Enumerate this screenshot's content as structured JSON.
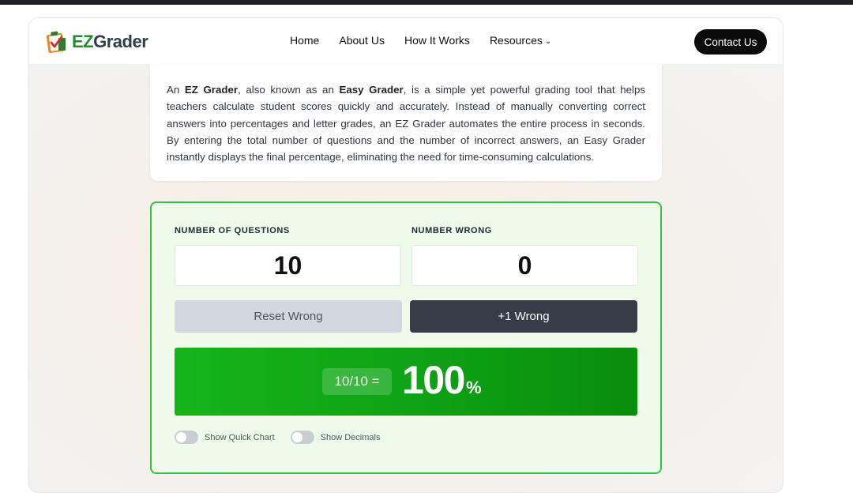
{
  "brand": {
    "ez": "EZ",
    "grader": "Grader"
  },
  "nav": {
    "home": "Home",
    "about": "About Us",
    "how": "How It Works",
    "resources": "Resources",
    "contact": "Contact Us"
  },
  "intro": {
    "p1": "An ",
    "b1": "EZ Grader",
    "p2": ", also known as an ",
    "b2": "Easy Grader",
    "p3": ", is a simple yet powerful grading tool that helps teachers calculate student scores quickly and accurately. Instead of manually converting correct answers into percentages and letter grades, an EZ Grader automates the entire process in seconds. By entering the total number of questions and the number of incorrect answers, an Easy Grader instantly displays the final percentage, eliminating the need for time-consuming calculations."
  },
  "calculator": {
    "questions_label": "NUMBER OF QUESTIONS",
    "questions_value": "10",
    "wrong_label": "NUMBER WRONG",
    "wrong_value": "0",
    "reset_label": "Reset Wrong",
    "plus_label": "+1 Wrong",
    "fraction": "10/10 =",
    "percent": "100",
    "percent_symbol": "%",
    "toggle_chart": "Show Quick Chart",
    "toggle_decimals": "Show Decimals"
  },
  "colors": {
    "accent_green": "#35c243",
    "result_green": "#0fa315",
    "dark_button": "#373d48",
    "brand_ez": "#1e8f2b"
  },
  "icons": {
    "logo": "clipboard-check-icon",
    "resources": "chevron-down-icon"
  }
}
